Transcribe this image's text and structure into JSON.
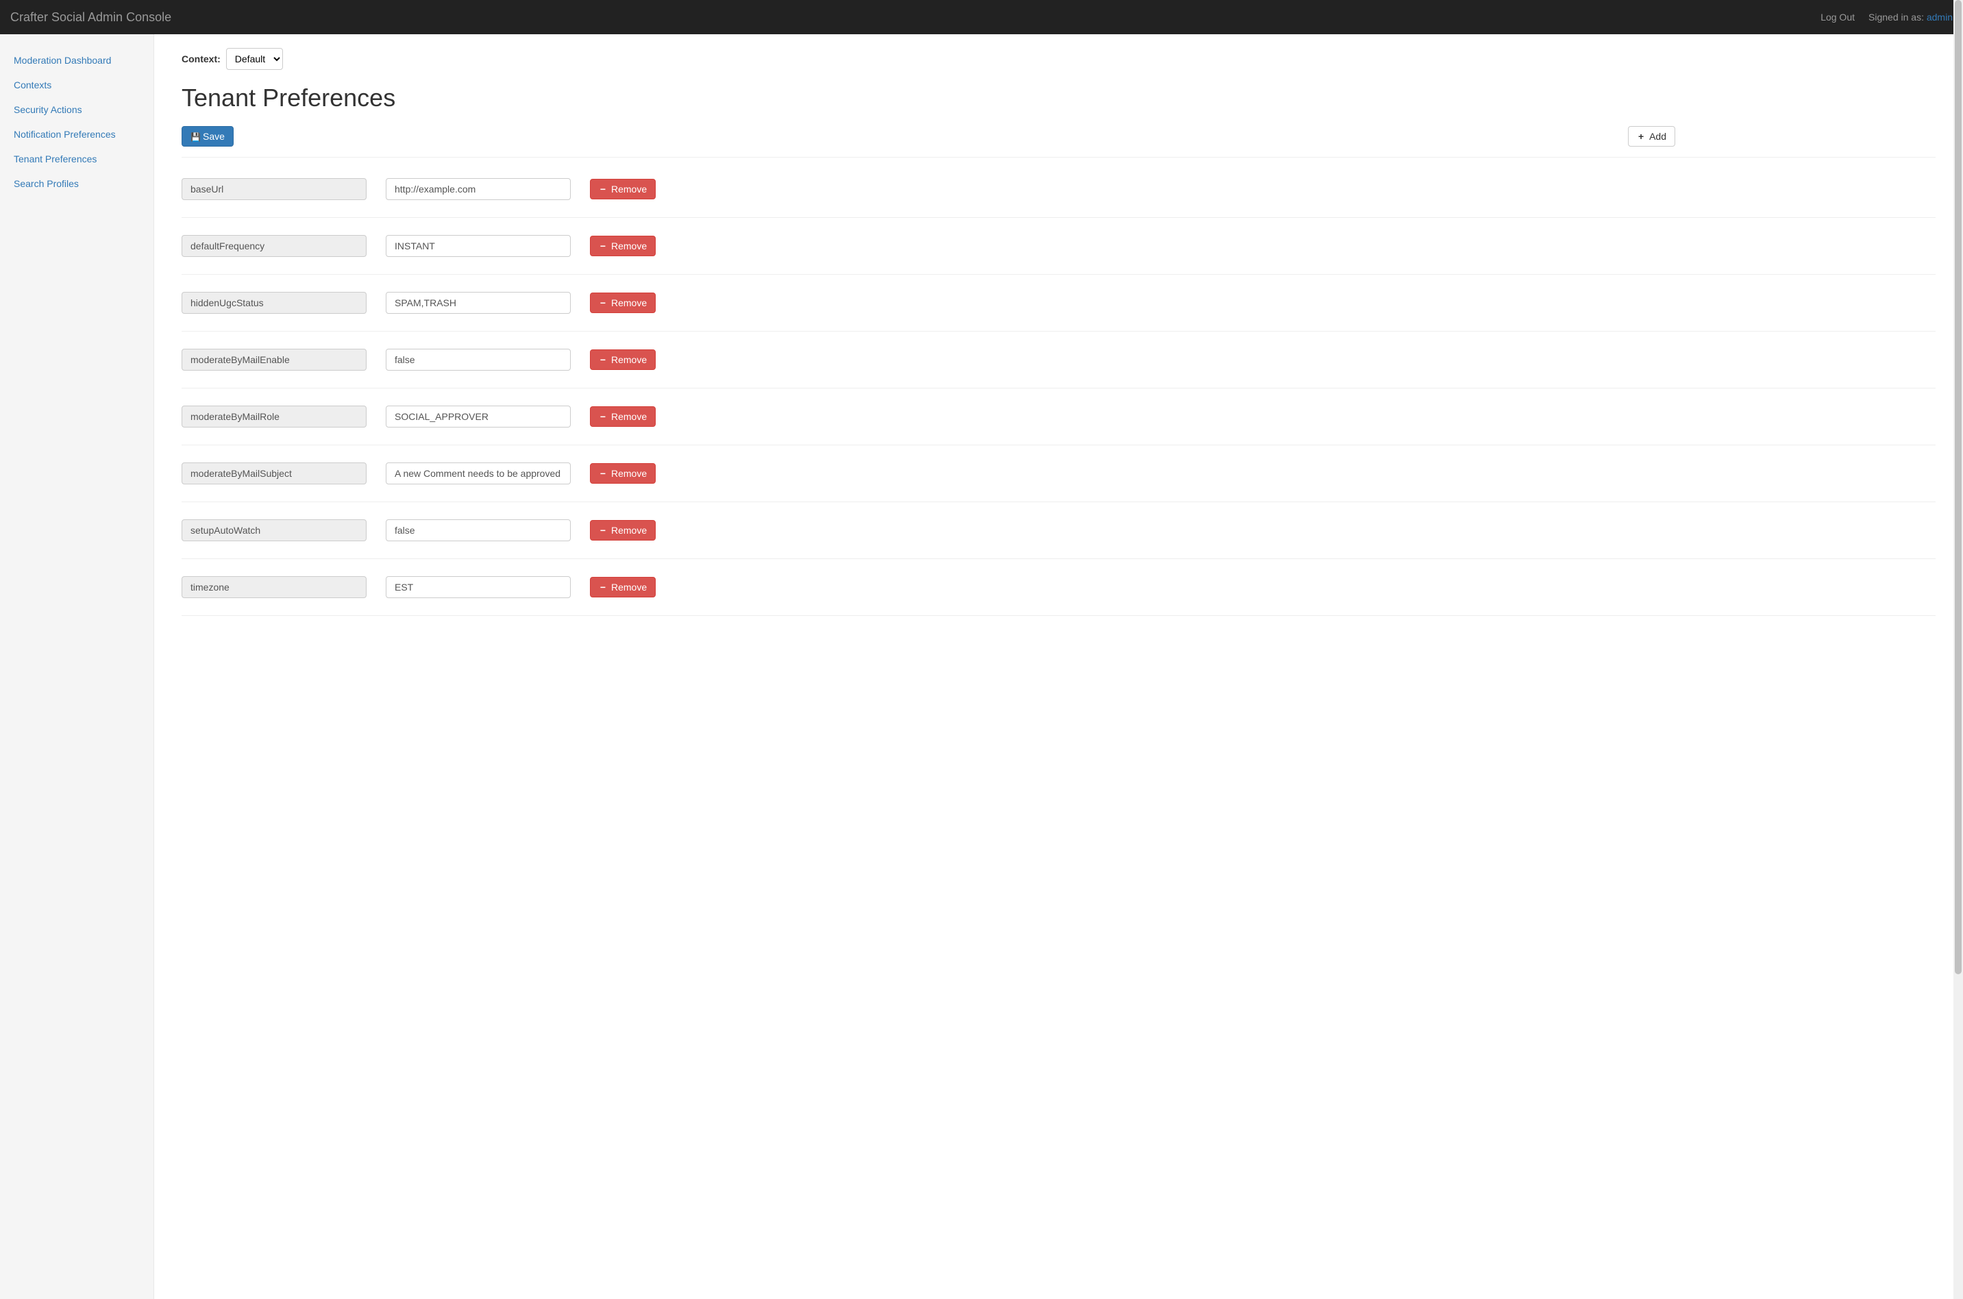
{
  "navbar": {
    "brand": "Crafter Social Admin Console",
    "logout": "Log Out",
    "signed_in_prefix": "Signed in as: ",
    "user": "admin"
  },
  "sidebar": {
    "items": [
      "Moderation Dashboard",
      "Contexts",
      "Security Actions",
      "Notification Preferences",
      "Tenant Preferences",
      "Search Profiles"
    ]
  },
  "context": {
    "label": "Context:",
    "selected": "Default"
  },
  "page": {
    "title": "Tenant Preferences",
    "save": "Save",
    "add": "Add",
    "remove": "Remove"
  },
  "prefs": [
    {
      "key": "baseUrl",
      "value": "http://example.com"
    },
    {
      "key": "defaultFrequency",
      "value": "INSTANT"
    },
    {
      "key": "hiddenUgcStatus",
      "value": "SPAM,TRASH"
    },
    {
      "key": "moderateByMailEnable",
      "value": "false"
    },
    {
      "key": "moderateByMailRole",
      "value": "SOCIAL_APPROVER"
    },
    {
      "key": "moderateByMailSubject",
      "value": "A new Comment needs to be approved"
    },
    {
      "key": "setupAutoWatch",
      "value": "false"
    },
    {
      "key": "timezone",
      "value": "EST"
    }
  ]
}
